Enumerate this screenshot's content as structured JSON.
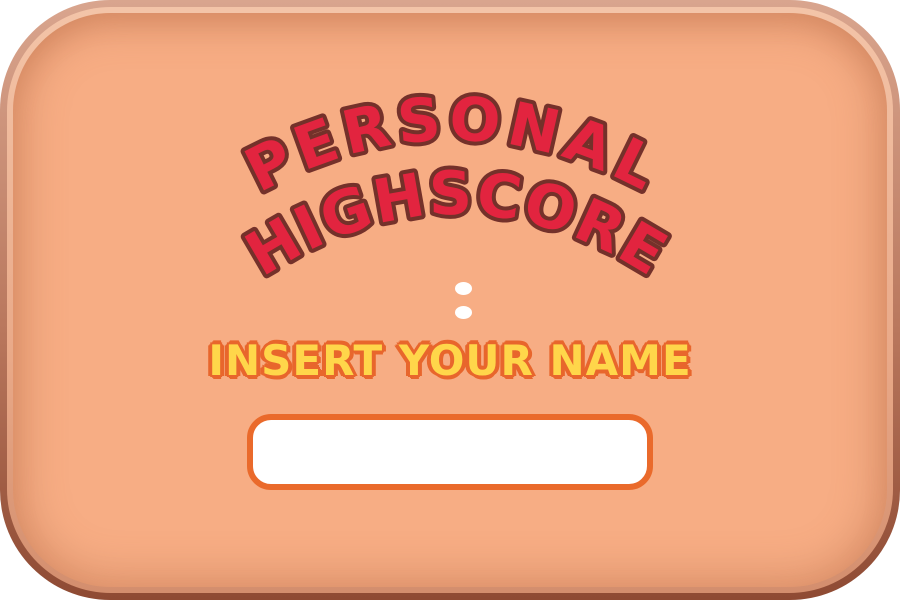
{
  "dialog": {
    "title_line1": "PERSONAL",
    "title_line2": "HIGHSCORE",
    "score_separator": ":",
    "score_value": "",
    "insert_label": "INSERT YOUR NAME",
    "name_input": {
      "value": "",
      "placeholder": ""
    }
  },
  "colors": {
    "panel_fill": "#f7ad84",
    "panel_rim": "#b9775d",
    "title_fill": "#e2243f",
    "title_outline": "#74312a",
    "label_fill": "#ffd64a",
    "label_outline": "#e8662c",
    "input_border": "#ea6a2b"
  }
}
